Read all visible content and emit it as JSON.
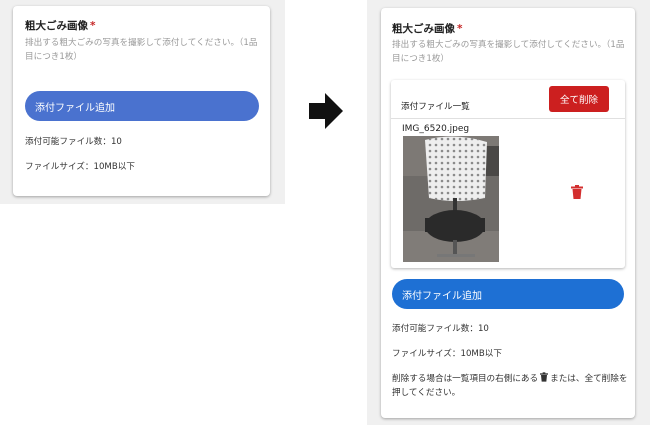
{
  "before": {
    "field": {
      "title": "粗大ごみ画像",
      "required_mark": "*",
      "description": "排出する粗大ごみの写真を撮影して添付してください。（1品目につき1枚）"
    },
    "add_button_label": "添付ファイル追加",
    "max_files_text": "添付可能ファイル数：10",
    "max_size_text": "ファイルサイズ：10MB以下"
  },
  "after": {
    "field": {
      "title": "粗大ごみ画像",
      "required_mark": "*",
      "description": "排出する粗大ごみの写真を撮影して添付してください。（1品目につき1枚）"
    },
    "file_list": {
      "header_label": "添付ファイル一覧",
      "delete_all_label": "全て削除",
      "files": [
        {
          "name": "IMG_6520.jpeg"
        }
      ]
    },
    "add_button_label": "添付ファイル追加",
    "max_files_text": "添付可能ファイル数：10",
    "max_size_text": "ファイルサイズ：10MB以下",
    "delete_hint_before": "削除する場合は一覧項目の右側にある",
    "delete_hint_after": "または、全て削除を押してください。"
  },
  "colors": {
    "primary_button_before": "#4a72cf",
    "primary_button_after": "#1e70d4",
    "danger": "#cc1f1f",
    "required": "#c62828",
    "trash_icon": "#d32f2f"
  },
  "icons": [
    "right-arrow-icon",
    "trash-icon"
  ]
}
